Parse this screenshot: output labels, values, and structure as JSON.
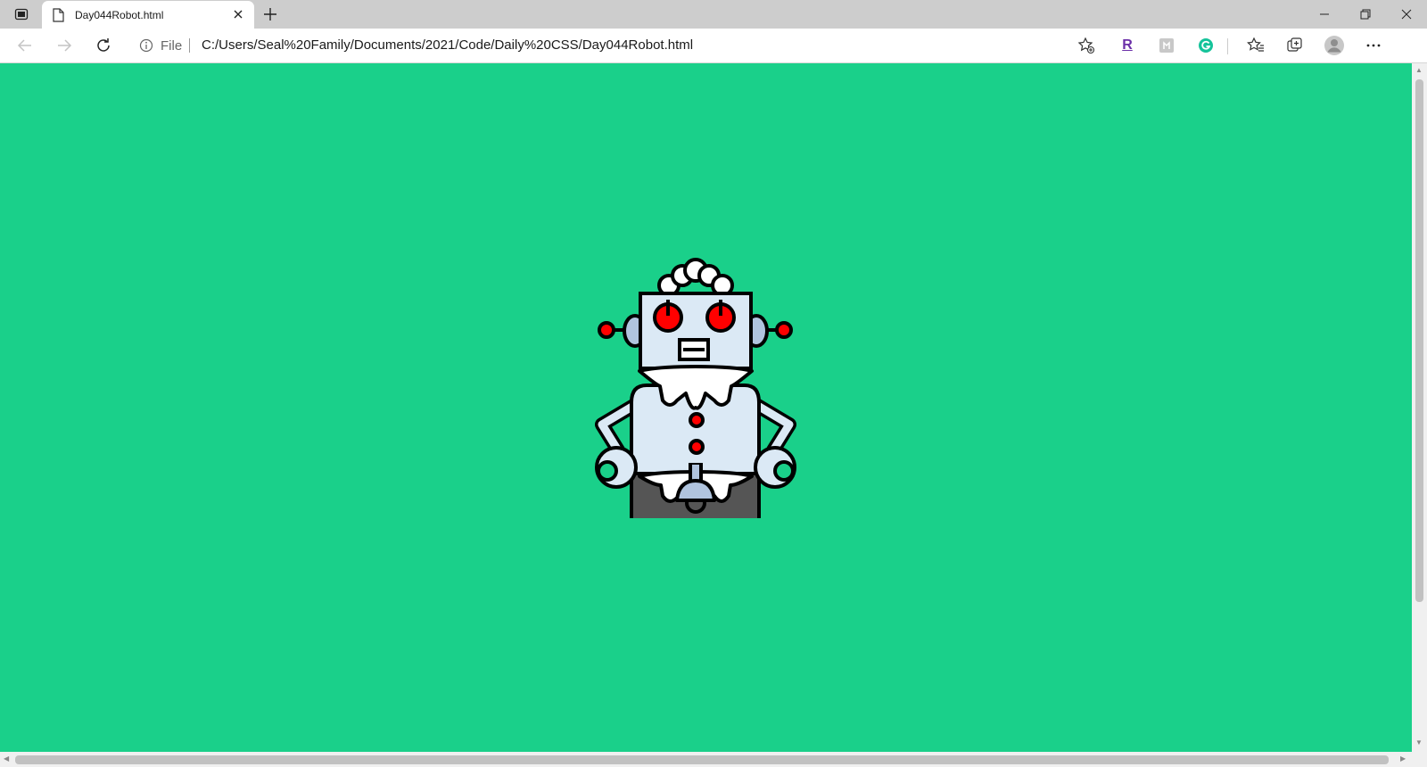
{
  "browser": {
    "tab": {
      "title": "Day044Robot.html"
    },
    "address_bar": {
      "scheme_label": "File",
      "url": "C:/Users/Seal%20Family/Documents/2021/Code/Daily%20CSS/Day044Robot.html"
    },
    "extensions": [
      "R",
      "grammarly"
    ],
    "icons": {
      "tab_actions": "tab-actions-icon",
      "new_tab": "plus-icon",
      "back": "back-arrow-icon",
      "forward": "forward-arrow-icon",
      "refresh": "refresh-icon",
      "info": "info-icon",
      "add_favorite": "star-add-icon",
      "favorites": "favorites-icon",
      "collections": "collections-icon",
      "profile": "avatar-icon",
      "menu": "more-icon"
    }
  },
  "page": {
    "background_color": "#1ad08a",
    "robot": {
      "eye_color": "#ff0000",
      "body_color": "#dbe9f5",
      "joint_color": "#b0c4de",
      "skirt_color": "#555555"
    }
  }
}
